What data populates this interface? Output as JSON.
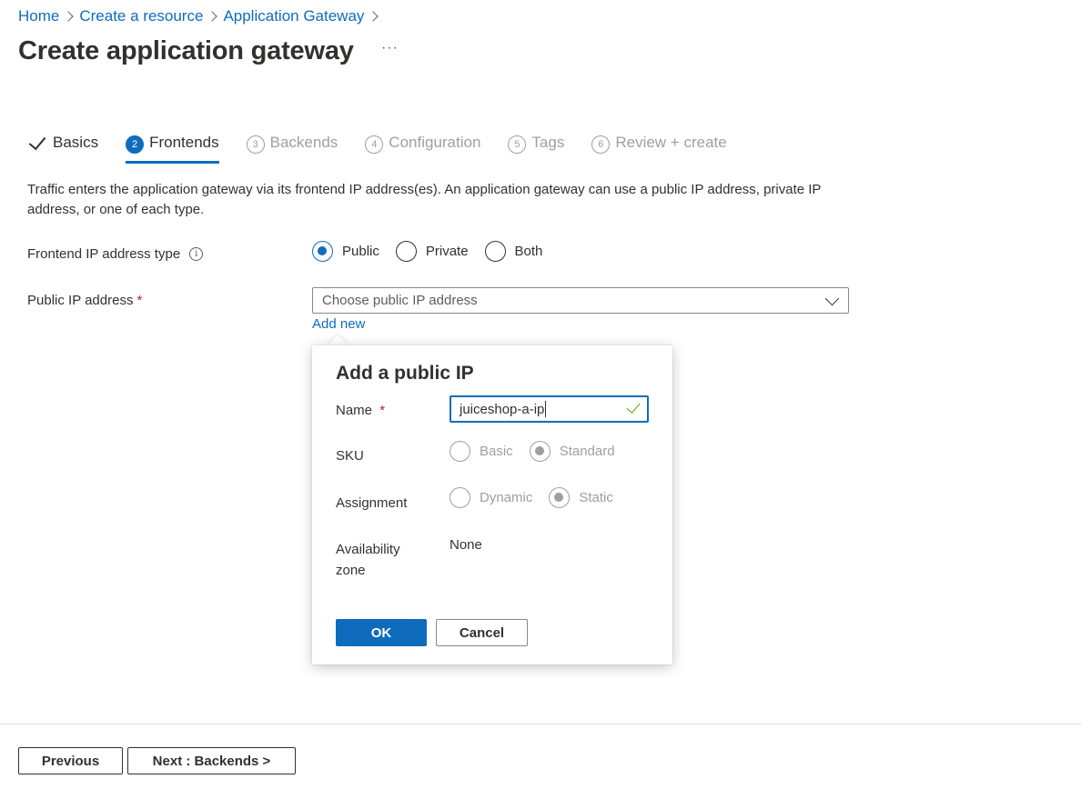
{
  "breadcrumb": {
    "items": [
      "Home",
      "Create a resource",
      "Application Gateway"
    ]
  },
  "page": {
    "title": "Create application gateway",
    "more_label": "···"
  },
  "tabs": [
    {
      "number": "",
      "label": "Basics",
      "state": "completed"
    },
    {
      "number": "2",
      "label": "Frontends",
      "state": "active"
    },
    {
      "number": "3",
      "label": "Backends",
      "state": "disabled"
    },
    {
      "number": "4",
      "label": "Configuration",
      "state": "disabled"
    },
    {
      "number": "5",
      "label": "Tags",
      "state": "disabled"
    },
    {
      "number": "6",
      "label": "Review + create",
      "state": "disabled"
    }
  ],
  "description": "Traffic enters the application gateway via its frontend IP address(es). An application gateway can use a public IP address, private IP address, or one of each type.",
  "frontend_ip_type": {
    "label": "Frontend IP address type",
    "info_icon": "i",
    "options": [
      "Public",
      "Private",
      "Both"
    ],
    "selected": "Public"
  },
  "public_ip": {
    "label": "Public IP address",
    "required_mark": "*",
    "placeholder": "Choose public IP address",
    "add_new_label": "Add new"
  },
  "callout": {
    "title": "Add a public IP",
    "name": {
      "label": "Name",
      "required_mark": "*",
      "value": "juiceshop-a-ip"
    },
    "sku": {
      "label": "SKU",
      "options": [
        "Basic",
        "Standard"
      ],
      "selected": "Standard"
    },
    "assignment": {
      "label": "Assignment",
      "options": [
        "Dynamic",
        "Static"
      ],
      "selected": "Static"
    },
    "availability_zone": {
      "label_line1": "Availability",
      "label_line2": "zone",
      "value": "None"
    },
    "ok_label": "OK",
    "cancel_label": "Cancel"
  },
  "footer": {
    "previous_label": "Previous",
    "next_label": "Next : Backends >"
  },
  "colors": {
    "accent": "#0f6cbd",
    "required": "#a4262c",
    "valid": "#57a300"
  }
}
